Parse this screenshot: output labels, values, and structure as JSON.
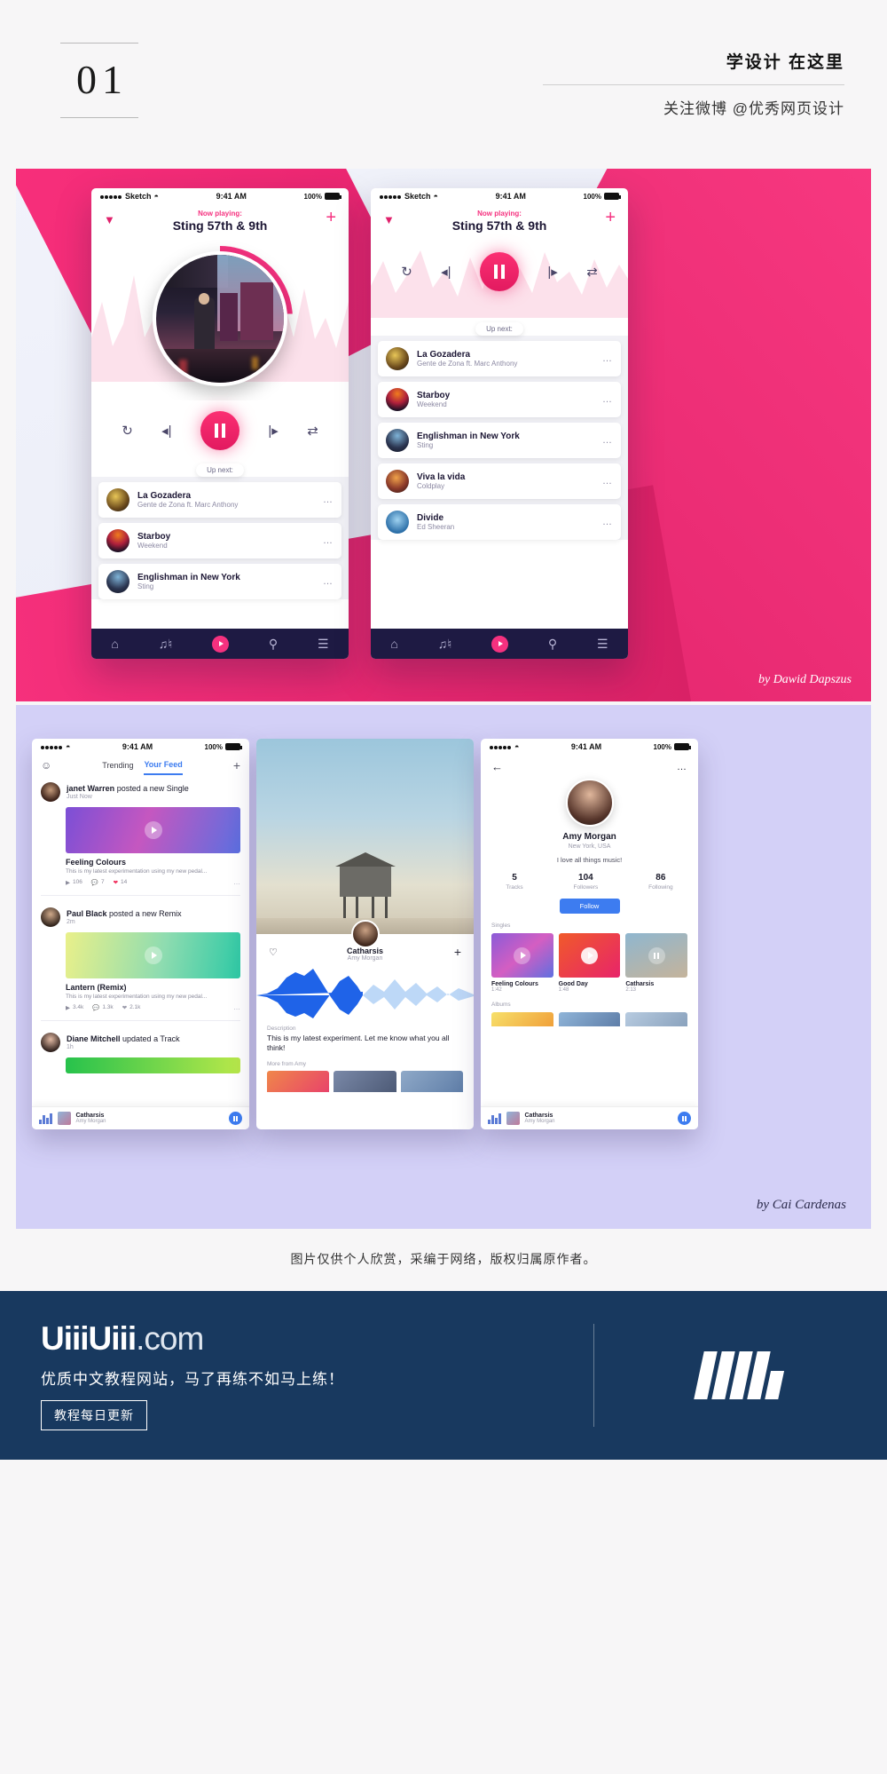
{
  "header": {
    "number": "01",
    "title": "学设计 在这里",
    "subtitle": "关注微博 @优秀网页设计"
  },
  "player": {
    "status": {
      "carrier": "Sketch",
      "time": "9:41 AM",
      "battery": "100%"
    },
    "now_playing_label": "Now playing:",
    "track_title": "Sting 57th & 9th",
    "collapse_icon": "chevron-down-icon",
    "add_icon": "plus-icon",
    "controls": {
      "repeat": "repeat-icon",
      "previous": "previous-icon",
      "play_pause": "pause-icon",
      "next": "next-icon",
      "shuffle": "shuffle-icon"
    },
    "up_next_label": "Up next:",
    "queue": [
      {
        "title": "La Gozadera",
        "artist": "Gente de Zona ft. Marc Anthony"
      },
      {
        "title": "Starboy",
        "artist": "Weekend"
      },
      {
        "title": "Englishman in New York",
        "artist": "Sting"
      },
      {
        "title": "Viva la vida",
        "artist": "Coldplay"
      },
      {
        "title": "Divide",
        "artist": "Ed Sheeran"
      }
    ],
    "nav": [
      "home-icon",
      "library-icon",
      "play-icon",
      "search-icon",
      "menu-icon"
    ],
    "credit": "by Dawid Dapszus",
    "accent": "#f5317f",
    "nav_bg": "#1e1a43"
  },
  "social": {
    "status": {
      "time": "9:41 AM",
      "battery": "100%"
    },
    "tabs": [
      {
        "label": "Trending",
        "active": false
      },
      {
        "label": "Your Feed",
        "active": true
      }
    ],
    "profile_icon": "person-icon",
    "add_icon": "plus-icon",
    "posts": [
      {
        "user": "janet Warren",
        "action": "posted a new Single",
        "time": "Just Now",
        "track": "Feeling Colours",
        "desc": "This is my latest experimentation using my new pedal...",
        "plays": "106",
        "comments": "7",
        "likes": "14"
      },
      {
        "user": "Paul Black",
        "action": "posted a new Remix",
        "time": "2m",
        "track": "Lantern (Remix)",
        "desc": "This is my latest experimentation using my new pedal...",
        "plays": "3.4k",
        "comments": "1.3k",
        "likes": "2.1k"
      },
      {
        "user": "Diane Mitchell",
        "action": "updated a Track",
        "time": "1h"
      }
    ],
    "mini_player": {
      "title": "Catharsis",
      "artist": "Amy Morgan",
      "button": "pause-icon"
    }
  },
  "track_page": {
    "like_icon": "heart-icon",
    "add_icon": "plus-icon",
    "title": "Catharsis",
    "artist": "Amy Morgan",
    "description_label": "Description",
    "description": "This is my latest experiment. Let me know what you all think!",
    "more_label": "More from Amy"
  },
  "profile": {
    "status": {
      "time": "9:41 AM",
      "battery": "100%"
    },
    "back_icon": "back-arrow-icon",
    "more_icon": "more-icon",
    "name": "Amy Morgan",
    "location": "New York, USA",
    "bio": "I love all things music!",
    "stats": [
      {
        "value": "5",
        "label": "Tracks"
      },
      {
        "value": "104",
        "label": "Followers"
      },
      {
        "value": "86",
        "label": "Following"
      }
    ],
    "follow_label": "Follow",
    "singles_label": "Singles",
    "albums_label": "Albums",
    "singles": [
      {
        "title": "Feeling Colours",
        "duration": "1:42",
        "state": "play"
      },
      {
        "title": "Good Day",
        "duration": "1:48",
        "state": "play"
      },
      {
        "title": "Catharsis",
        "duration": "2:13",
        "state": "pause"
      }
    ],
    "mini_player": {
      "title": "Catharsis",
      "artist": "Amy Morgan",
      "button": "pause-icon"
    }
  },
  "credit2": "by Cai Cardenas",
  "caption": "图片仅供个人欣赏，采编于网络，版权归属原作者。",
  "footer": {
    "logo_main": "UiiiUiii",
    "logo_suffix": ".com",
    "tagline": "优质中文教程网站，马了再练不如马上练！",
    "badge": "教程每日更新",
    "bg": "#18395f"
  }
}
